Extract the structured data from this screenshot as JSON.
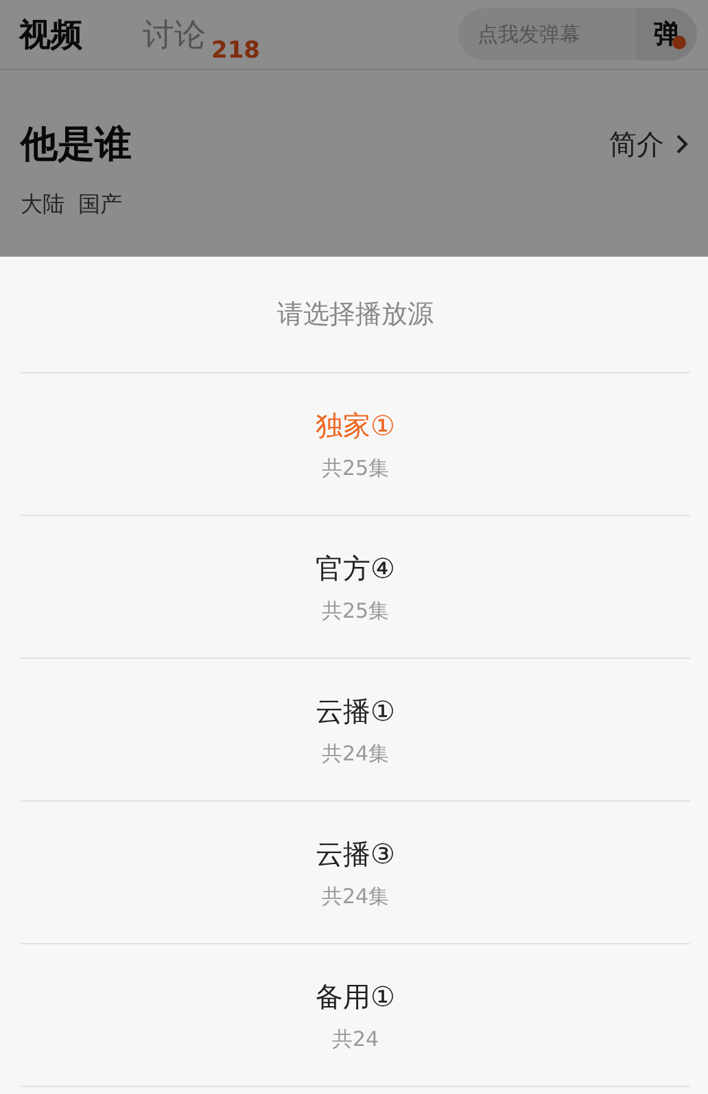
{
  "tabs": [
    {
      "label": "视频",
      "selected": true
    },
    {
      "label": "讨论",
      "selected": false,
      "count": "218"
    }
  ],
  "danmaku": {
    "placeholder": "点我发弹幕",
    "toggle": "弹",
    "on": true
  },
  "show": {
    "title": "他是谁",
    "intro_link": "简介",
    "tags": [
      "大陆",
      "国产"
    ]
  },
  "dimmed": true,
  "sheet": {
    "title": "请选择播放源",
    "sources": [
      {
        "name": "独家①",
        "episodes": "共25集",
        "selected": true
      },
      {
        "name": "官方④",
        "episodes": "共25集",
        "selected": false
      },
      {
        "name": "云播①",
        "episodes": "共24集",
        "selected": false
      },
      {
        "name": "云播③",
        "episodes": "共24集",
        "selected": false
      },
      {
        "name": "备用①",
        "episodes": "共24",
        "selected": false
      }
    ]
  }
}
